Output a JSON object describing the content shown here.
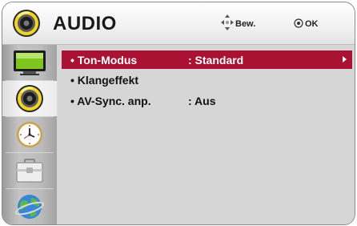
{
  "header": {
    "title": "AUDIO",
    "move_hint": "Bew.",
    "ok_hint": "OK"
  },
  "sidebar": {
    "items": [
      {
        "name": "picture",
        "icon": "tv-icon",
        "active": false
      },
      {
        "name": "audio",
        "icon": "speaker-icon",
        "active": true
      },
      {
        "name": "time",
        "icon": "clock-icon",
        "active": false
      },
      {
        "name": "option",
        "icon": "toolbox-icon",
        "active": false
      },
      {
        "name": "network",
        "icon": "globe-icon",
        "active": false
      }
    ]
  },
  "menu": {
    "items": [
      {
        "label": "• Ton-Modus",
        "value": ": Standard",
        "selected": true,
        "has_submenu": true
      },
      {
        "label": "• Klangeffekt",
        "value": "",
        "selected": false,
        "has_submenu": false
      },
      {
        "label": "• AV-Sync. anp.",
        "value": ": Aus",
        "selected": false,
        "has_submenu": false
      }
    ]
  },
  "colors": {
    "selection": "#aa1233",
    "speaker_ring": "#f1d42a",
    "background": "#d6d6d6"
  }
}
